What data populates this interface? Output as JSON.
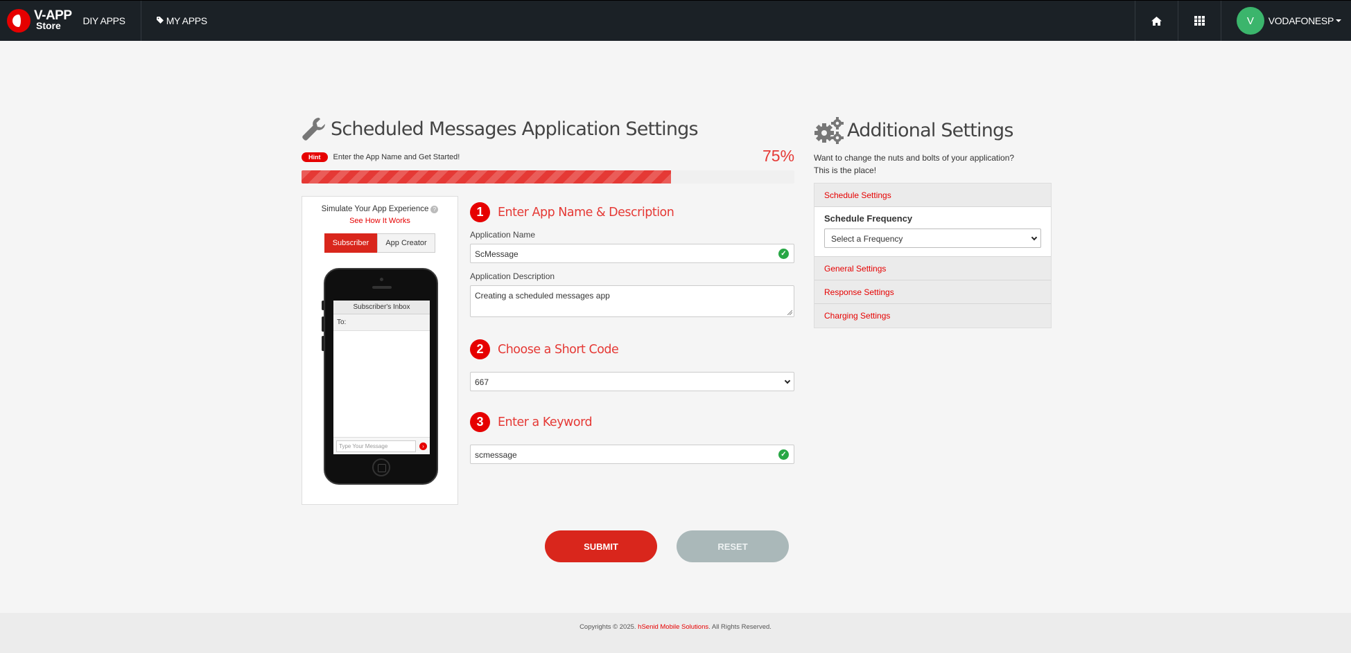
{
  "navbar": {
    "brand_top": "V-APP",
    "brand_bottom": "Store",
    "diy_label": "DIY APPS",
    "myapps_label": "MY APPS",
    "user_initial": "V",
    "user_name": "VODAFONESP"
  },
  "left": {
    "title": "Scheduled Messages Application Settings",
    "hint_badge": "Hint",
    "hint_text": "Enter the App Name and Get Started!",
    "progress_percent": 75,
    "progress_label": "75%"
  },
  "simulator": {
    "title": "Simulate Your App Experience",
    "help_glyph": "?",
    "link": "See How It Works",
    "tab_subscriber": "Subscriber",
    "tab_creator": "App Creator",
    "inbox_header": "Subscriber's Inbox",
    "to_label": "To:",
    "message_placeholder": "Type Your Message"
  },
  "steps": [
    {
      "num": "1",
      "title": "Enter App Name & Description"
    },
    {
      "num": "2",
      "title": "Choose a Short Code"
    },
    {
      "num": "3",
      "title": "Enter a Keyword"
    }
  ],
  "form": {
    "app_name_label": "Application Name",
    "app_name_value": "ScMessage",
    "app_desc_label": "Application Description",
    "app_desc_value": "Creating a scheduled messages app",
    "short_code_value": "667",
    "keyword_value": "scmessage"
  },
  "buttons": {
    "submit": "SUBMIT",
    "reset": "RESET"
  },
  "additional": {
    "title": "Additional Settings",
    "desc_line1": "Want to change the nuts and bolts of your application?",
    "desc_line2": "This is the place!",
    "sections": [
      "Schedule Settings",
      "General Settings",
      "Response Settings",
      "Charging Settings"
    ],
    "schedule_label": "Schedule Frequency",
    "schedule_select": "Select a Frequency"
  },
  "footer": {
    "prefix": "Copyrights © 2025.",
    "company": "hSenid Mobile Solutions",
    "suffix": ". All Rights Reserved."
  },
  "colors": {
    "accent": "#e60000",
    "navbar": "#1b2126",
    "success": "#28a745",
    "avatar": "#3bb56c"
  }
}
